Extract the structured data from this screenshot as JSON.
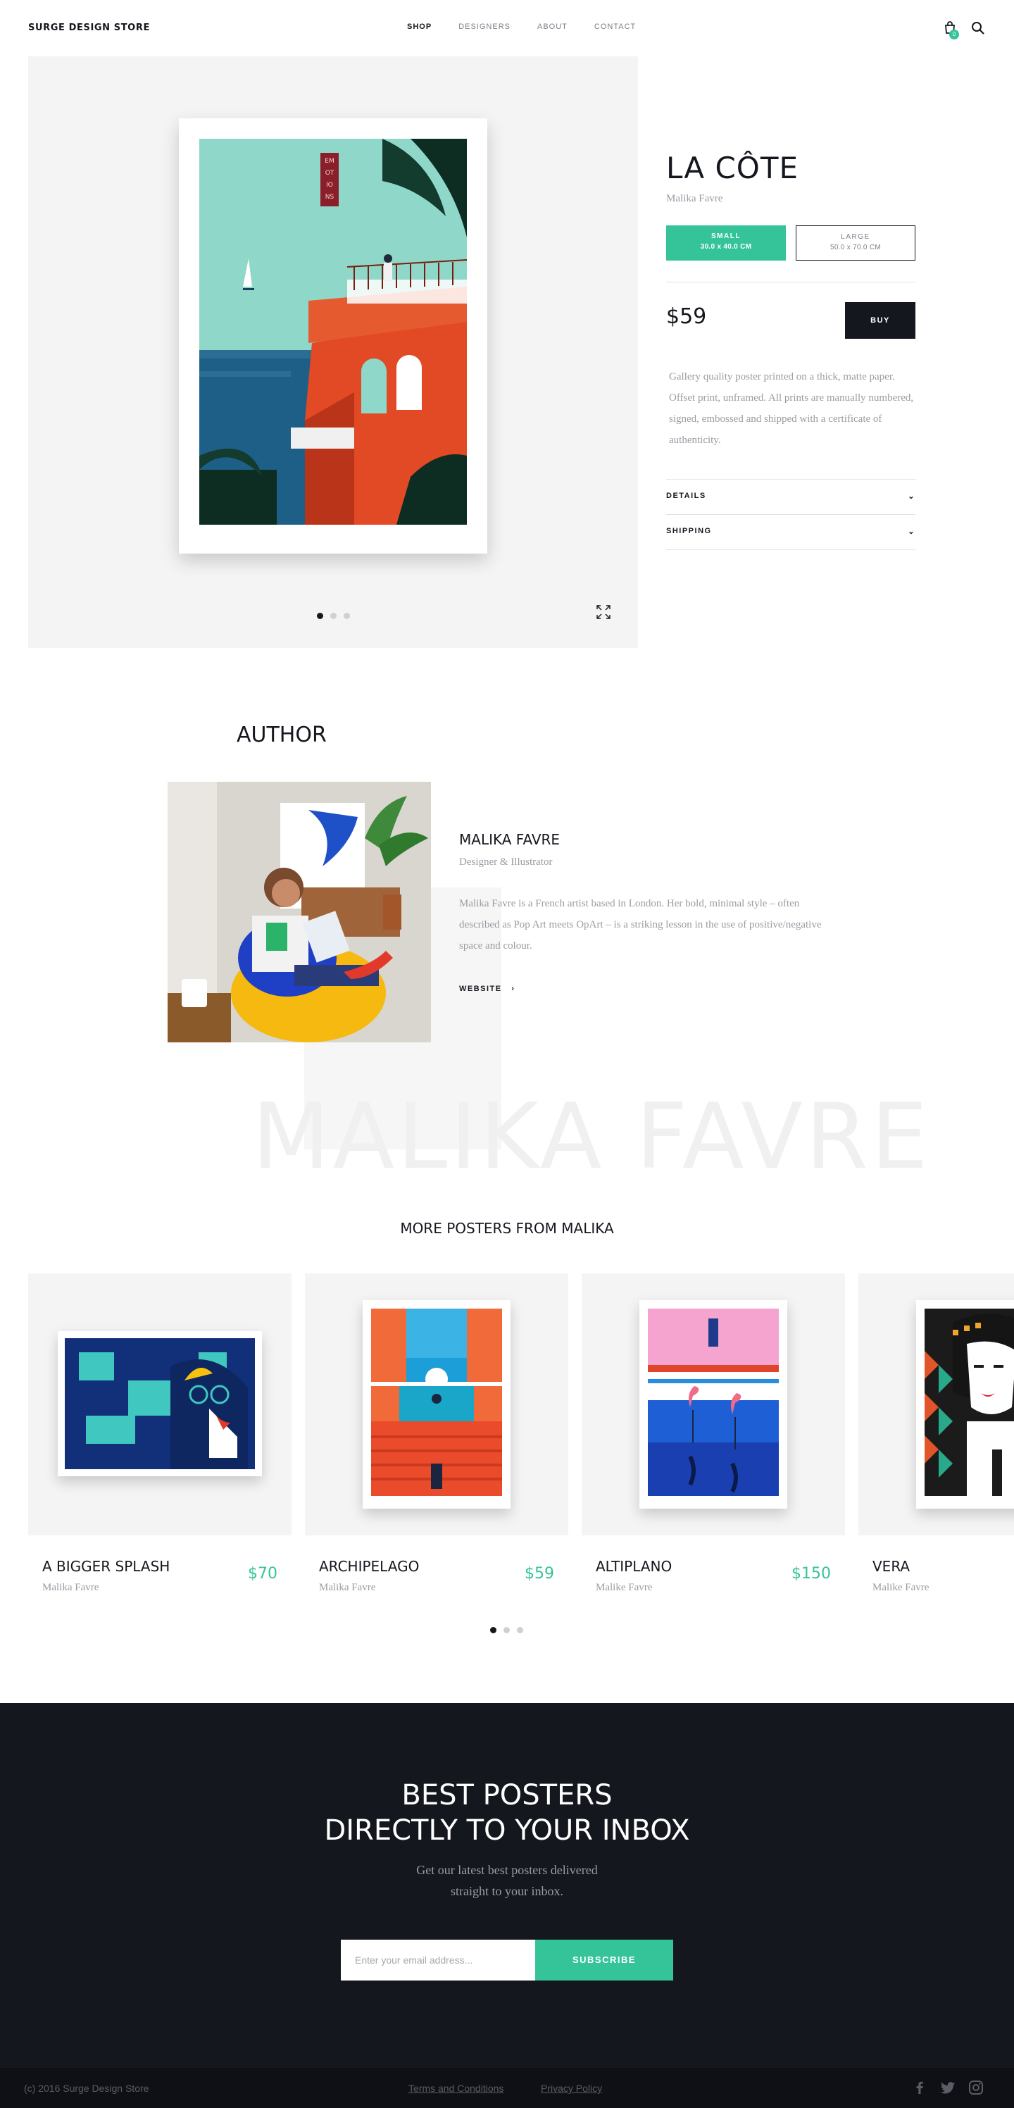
{
  "header": {
    "brand": "SURGE DESIGN STORE",
    "nav": [
      "SHOP",
      "DESIGNERS",
      "ABOUT",
      "CONTACT"
    ],
    "cart_count": "0"
  },
  "product": {
    "title": "LA CÔTE",
    "author": "Malika Favre",
    "sizes": [
      {
        "label": "SMALL",
        "dim": "30.0 x 40.0 CM"
      },
      {
        "label": "LARGE",
        "dim": "50.0 x 70.0 CM"
      }
    ],
    "price": "$59",
    "buy_label": "BUY",
    "description": "Gallery quality poster printed on a thick, matte paper. Offset print, unframed. All prints are manually numbered, signed, embossed and shipped with a certificate of authenticity.",
    "accordion": [
      "DETAILS",
      "SHIPPING"
    ],
    "poster_text": [
      "EM",
      "OT",
      "IO",
      "NS"
    ]
  },
  "author": {
    "heading": "AUTHOR",
    "name": "MALIKA FAVRE",
    "role": "Designer & Illustrator",
    "bio": "Malika Favre is a French artist based in London. Her bold, minimal style – often described as Pop Art meets OpArt – is a striking lesson in the use of positive/negative space and colour.",
    "website_label": "WEBSITE",
    "watermark": "MALIKA FAVRE"
  },
  "more": {
    "heading": "MORE POSTERS FROM MALIKA",
    "cards": [
      {
        "title": "A BIGGER SPLASH",
        "author": "Malika Favre",
        "price": "$70"
      },
      {
        "title": "ARCHIPELAGO",
        "author": "Malika Favre",
        "price": "$59"
      },
      {
        "title": "ALTIPLANO",
        "author": "Malike Favre",
        "price": "$150"
      },
      {
        "title": "VERA",
        "author": "Malike Favre",
        "price": ""
      }
    ]
  },
  "newsletter": {
    "title_line1": "BEST POSTERS",
    "title_line2": "DIRECTLY TO YOUR INBOX",
    "sub_line1": "Get our latest best posters delivered",
    "sub_line2": "straight to your inbox.",
    "placeholder": "Enter your email address...",
    "button": "SUBSCRIBE"
  },
  "footer": {
    "copyright": "(c) 2016 Surge Design Store",
    "links": [
      "Terms and Conditions",
      "Privacy Policy"
    ],
    "social": [
      "facebook-icon",
      "twitter-icon",
      "instagram-icon"
    ]
  },
  "colors": {
    "accent": "#35c49a",
    "dark": "#15171e",
    "muted": "#9a9ca3"
  }
}
